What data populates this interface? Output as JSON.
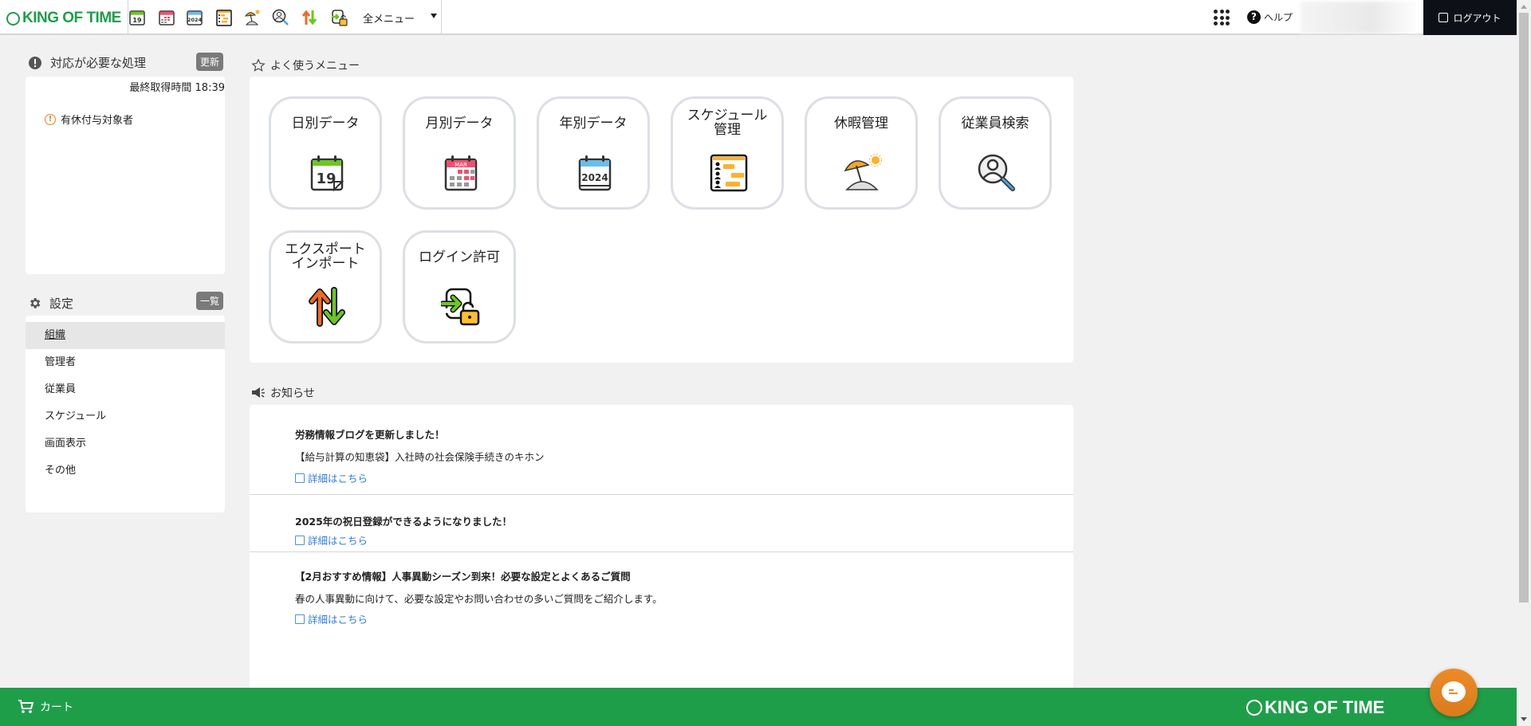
{
  "header": {
    "logo": "KING OF TIME",
    "quick_icons": [
      "daily-calendar-icon",
      "monthly-calendar-icon",
      "yearly-calendar-icon",
      "schedule-icon",
      "vacation-icon",
      "employee-search-icon",
      "export-import-icon",
      "login-permission-icon"
    ],
    "all_menu": "全メニュー",
    "help": "ヘルプ",
    "logout": "ログアウト"
  },
  "alerts": {
    "title": "対応が必要な処理",
    "refresh": "更新",
    "last_fetched": "最終取得時間 18:39",
    "items": [
      {
        "label": "有休付与対象者"
      }
    ]
  },
  "settings": {
    "title": "設定",
    "list_button": "一覧",
    "items": [
      {
        "label": "組織"
      },
      {
        "label": "管理者"
      },
      {
        "label": "従業員"
      },
      {
        "label": "スケジュール"
      },
      {
        "label": "画面表示"
      },
      {
        "label": "その他"
      }
    ]
  },
  "favorites": {
    "title": "よく使うメニュー",
    "tiles": [
      {
        "line1": "日別データ",
        "line2": ""
      },
      {
        "line1": "月別データ",
        "line2": ""
      },
      {
        "line1": "年別データ",
        "line2": ""
      },
      {
        "line1": "スケジュール",
        "line2": "管理"
      },
      {
        "line1": "休暇管理",
        "line2": ""
      },
      {
        "line1": "従業員検索",
        "line2": ""
      },
      {
        "line1": "エクスポート",
        "line2": "インポート"
      },
      {
        "line1": "ログイン許可",
        "line2": ""
      }
    ],
    "calendar_month": "MAR",
    "calendar_day": "19",
    "calendar_year": "2024"
  },
  "news": {
    "title": "お知らせ",
    "items": [
      {
        "title": "労務情報ブログを更新しました！",
        "desc": "【給与計算の知恵袋】入社時の社会保険手続きのキホン",
        "link": "詳細はこちら"
      },
      {
        "title": "2025年の祝日登録ができるようになりました！",
        "desc": "",
        "link": "詳細はこちら"
      },
      {
        "title": "【2月おすすめ情報】人事異動シーズン到来！必要な設定とよくあるご質問",
        "desc": "春の人事異動に向けて、必要な設定やお問い合わせの多いご質問をご紹介します。",
        "link": "詳細はこちら"
      }
    ]
  },
  "footer": {
    "cart": "カート",
    "logo": "KING OF TIME"
  },
  "colors": {
    "brand_green": "#1f9e4a",
    "chat_orange": "#ef8a25",
    "link_blue": "#2f7de1",
    "logout_bg": "#0d1117"
  }
}
